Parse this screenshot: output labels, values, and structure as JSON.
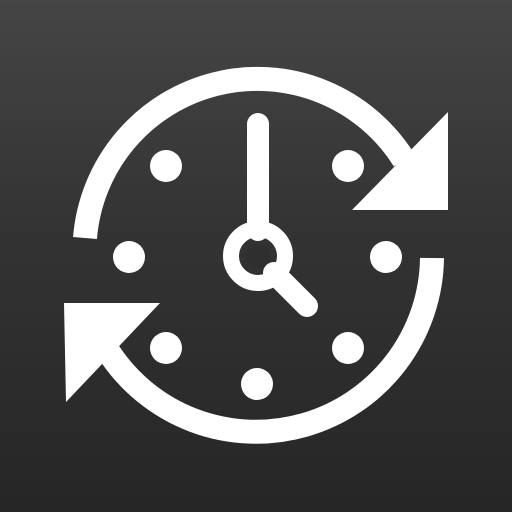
{
  "app_icon": {
    "icon": "clock-sync-icon",
    "background_color_top": "#454545",
    "background_color_bottom": "#262626",
    "glyph_color": "#ffffff",
    "clock_time": "5:00",
    "hour_markers": 8
  }
}
